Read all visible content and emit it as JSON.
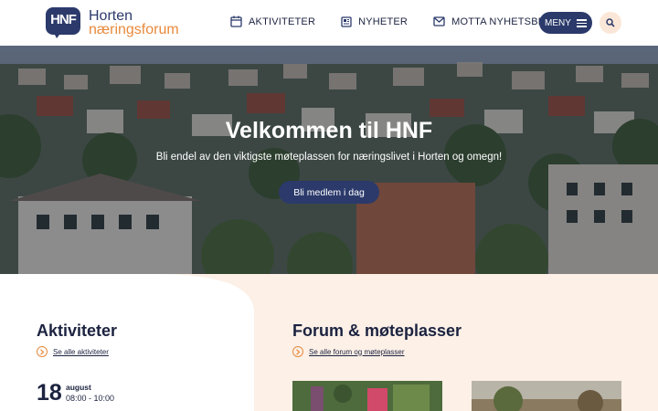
{
  "brand": {
    "logo_mark": "HNF",
    "name_line1": "Horten",
    "name_line2": "næringsforum"
  },
  "nav": {
    "items": [
      {
        "label": "AKTIVITETER",
        "icon": "calendar-icon"
      },
      {
        "label": "NYHETER",
        "icon": "newspaper-icon"
      },
      {
        "label": "MOTTA NYHETSBREV",
        "icon": "envelope-icon"
      }
    ],
    "menu_label": "MENY",
    "search_icon": "search-icon"
  },
  "hero": {
    "title": "Velkommen til HNF",
    "subtitle": "Bli endel av den viktigste møteplassen for næringslivet i Horten og omegn!",
    "cta_label": "Bli medlem i dag"
  },
  "activities": {
    "title": "Aktiviteter",
    "see_all": "Se alle aktiviteter",
    "event": {
      "day": "18",
      "month": "august",
      "time": "08:00 - 10:00"
    }
  },
  "forum": {
    "title": "Forum & møteplasser",
    "see_all": "Se alle forum og møteplasser"
  },
  "colors": {
    "navy": "#2b3a6b",
    "accent_orange": "#e88a3c",
    "section_bg": "#fcf0e7"
  }
}
